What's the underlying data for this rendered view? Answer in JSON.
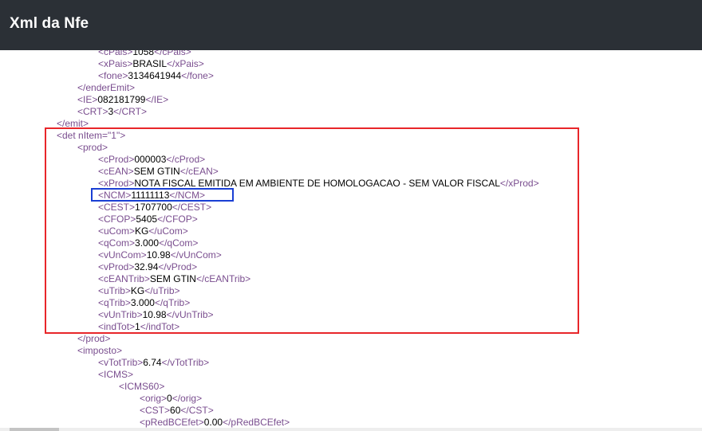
{
  "header": {
    "title": "Xml da Nfe"
  },
  "xml_lines": [
    {
      "open": "<cPais>",
      "value": "1058",
      "close": "</cPais>",
      "indent": 2,
      "y": 0
    },
    {
      "open": "<xPais>",
      "value": "BRASIL",
      "close": "</xPais>",
      "indent": 2,
      "y": 1
    },
    {
      "open": "<fone>",
      "value": "3134641944",
      "close": "</fone>",
      "indent": 2,
      "y": 2
    },
    {
      "open": "</enderEmit>",
      "value": "",
      "close": "",
      "indent": 1,
      "y": 3
    },
    {
      "open": "<IE>",
      "value": "082181799",
      "close": "</IE>",
      "indent": 1,
      "y": 4
    },
    {
      "open": "<CRT>",
      "value": "3",
      "close": "</CRT>",
      "indent": 1,
      "y": 5
    },
    {
      "open": "</emit>",
      "value": "",
      "close": "",
      "indent": 0,
      "y": 6
    },
    {
      "open": "<det nItem=\"1\">",
      "value": "",
      "close": "",
      "indent": 0,
      "y": 7
    },
    {
      "open": "<prod>",
      "value": "",
      "close": "",
      "indent": 1,
      "y": 8
    },
    {
      "open": "<cProd>",
      "value": "000003",
      "close": "</cProd>",
      "indent": 2,
      "y": 9
    },
    {
      "open": "<cEAN>",
      "value": "SEM GTIN",
      "close": "</cEAN>",
      "indent": 2,
      "y": 10
    },
    {
      "open": "<xProd>",
      "value": "NOTA FISCAL EMITIDA EM AMBIENTE DE HOMOLOGACAO - SEM VALOR FISCAL",
      "close": "</xProd>",
      "indent": 2,
      "y": 11
    },
    {
      "open": "<NCM>",
      "value": "11111113",
      "close": "</NCM>",
      "indent": 2,
      "y": 12
    },
    {
      "open": "<CEST>",
      "value": "1707700",
      "close": "</CEST>",
      "indent": 2,
      "y": 13
    },
    {
      "open": "<CFOP>",
      "value": "5405",
      "close": "</CFOP>",
      "indent": 2,
      "y": 14
    },
    {
      "open": "<uCom>",
      "value": "KG",
      "close": "</uCom>",
      "indent": 2,
      "y": 15
    },
    {
      "open": "<qCom>",
      "value": "3.000",
      "close": "</qCom>",
      "indent": 2,
      "y": 16
    },
    {
      "open": "<vUnCom>",
      "value": "10.98",
      "close": "</vUnCom>",
      "indent": 2,
      "y": 17
    },
    {
      "open": "<vProd>",
      "value": "32.94",
      "close": "</vProd>",
      "indent": 2,
      "y": 18
    },
    {
      "open": "<cEANTrib>",
      "value": "SEM GTIN",
      "close": "</cEANTrib>",
      "indent": 2,
      "y": 19
    },
    {
      "open": "<uTrib>",
      "value": "KG",
      "close": "</uTrib>",
      "indent": 2,
      "y": 20
    },
    {
      "open": "<qTrib>",
      "value": "3.000",
      "close": "</qTrib>",
      "indent": 2,
      "y": 21
    },
    {
      "open": "<vUnTrib>",
      "value": "10.98",
      "close": "</vUnTrib>",
      "indent": 2,
      "y": 22
    },
    {
      "open": "<indTot>",
      "value": "1",
      "close": "</indTot>",
      "indent": 2,
      "y": 23
    },
    {
      "open": "</prod>",
      "value": "",
      "close": "",
      "indent": 1,
      "y": 24
    },
    {
      "open": "<imposto>",
      "value": "",
      "close": "",
      "indent": 1,
      "y": 25
    },
    {
      "open": "<vTotTrib>",
      "value": "6.74",
      "close": "</vTotTrib>",
      "indent": 2,
      "y": 26
    },
    {
      "open": "<ICMS>",
      "value": "",
      "close": "",
      "indent": 2,
      "y": 27
    },
    {
      "open": "<ICMS60>",
      "value": "",
      "close": "",
      "indent": 3,
      "y": 28
    },
    {
      "open": "<orig>",
      "value": "0",
      "close": "</orig>",
      "indent": 4,
      "y": 29
    },
    {
      "open": "<CST>",
      "value": "60",
      "close": "</CST>",
      "indent": 4,
      "y": 30
    },
    {
      "open": "<pRedBCEfet>",
      "value": "0.00",
      "close": "</pRedBCEfet>",
      "indent": 4,
      "y": 31
    }
  ],
  "colors": {
    "header_bg": "#2b3036",
    "tag": "#7a4e8f",
    "highlight_red": "#e8262a",
    "highlight_blue": "#1a3fd4"
  }
}
